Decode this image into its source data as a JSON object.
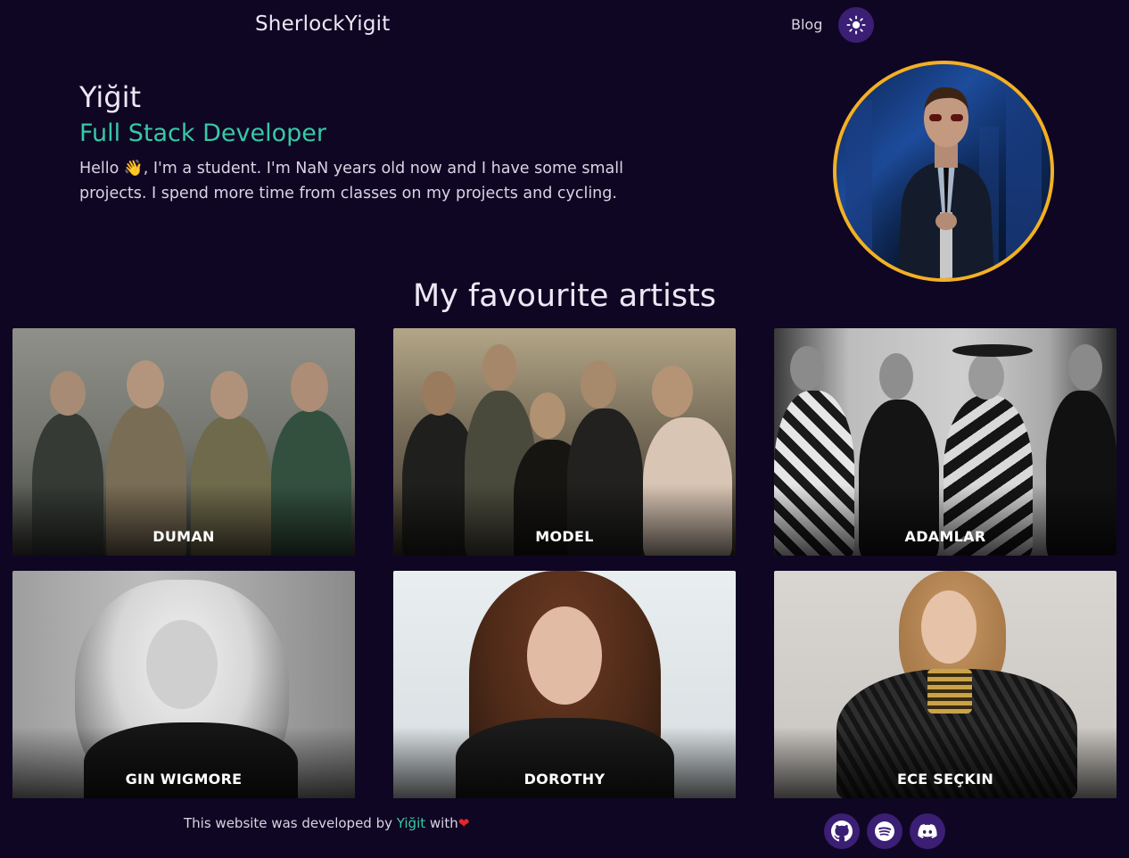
{
  "header": {
    "site_title": "SherlockYigit",
    "nav_blog": "Blog"
  },
  "hero": {
    "name": "Yiğit",
    "role": "Full Stack Developer",
    "bio": "Hello 👋, I'm a student. I'm NaN years old now and I have some small projects. I spend more time from classes on my projects and cycling."
  },
  "section": {
    "title": "My favourite artists"
  },
  "artists": [
    {
      "name": "DUMAN"
    },
    {
      "name": "MODEL"
    },
    {
      "name": "ADAMLAR"
    },
    {
      "name": "GIN WIGMORE"
    },
    {
      "name": "DOROTHY"
    },
    {
      "name": "ECE SEÇKIN"
    }
  ],
  "footer": {
    "text_prefix": "This website was developed by ",
    "author": "Yiğit",
    "text_suffix": " with",
    "heart": "❤"
  },
  "social": [
    "github-icon",
    "spotify-icon",
    "discord-icon"
  ],
  "colors": {
    "background": "#0f0623",
    "accent": "#37c9a6",
    "button_bg": "#3a1f74",
    "avatar_border": "#f3b023"
  }
}
